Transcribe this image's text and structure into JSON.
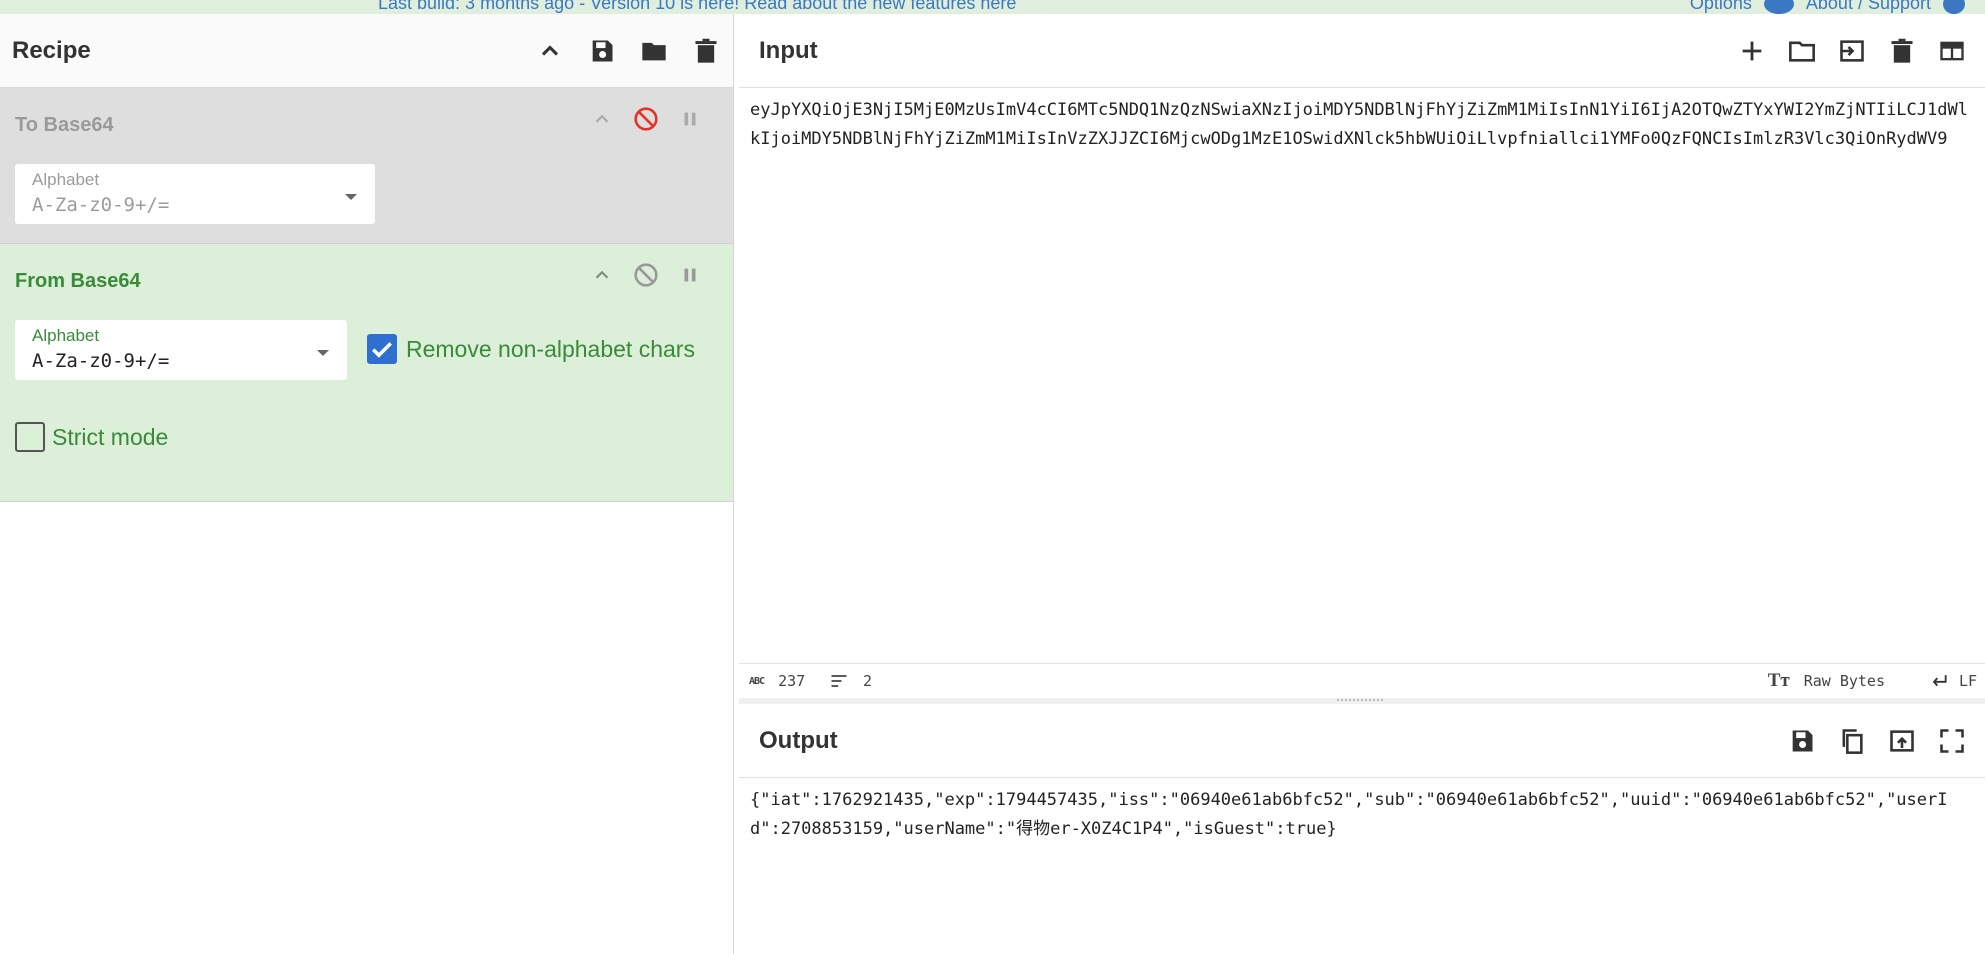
{
  "banner": {
    "text": "Last build: 3 months ago - Version 10 is here! Read about the new features here",
    "options": "Options",
    "about": "About / Support"
  },
  "recipe": {
    "title": "Recipe",
    "operations": [
      {
        "name": "To Base64",
        "disabled": true,
        "alphabet_label": "Alphabet",
        "alphabet_value": "A-Za-z0-9+/="
      },
      {
        "name": "From Base64",
        "disabled": false,
        "alphabet_label": "Alphabet",
        "alphabet_value": "A-Za-z0-9+/=",
        "remove_nonalpha_label": "Remove non-alphabet chars",
        "remove_nonalpha_checked": true,
        "strict_label": "Strict mode",
        "strict_checked": false
      }
    ]
  },
  "input": {
    "title": "Input",
    "text": "eyJpYXQiOjE3NjI5MjE0MzUsImV4cCI6MTc5NDQ1NzQzNSwiaXNzIjoiMDY5NDBlNjFhYjZiZmM1MiIsInN1YiI6IjA2OTQwZTYxYWI2YmZjNTIiLCJ1dWlkIjoiMDY5NDBlNjFhYjZiZmM1MiIsInVzZXJJZCI6MjcwODg1MzE1OSwidXNlck5hbWUiOiLlvpfniallci1YMFo0QzFQNCIsImlzR3Vlc3QiOnRydWV9",
    "status": {
      "chars": "237",
      "lines": "2",
      "encoding": "Raw Bytes",
      "eol": "LF"
    }
  },
  "output": {
    "title": "Output",
    "text": "{\"iat\":1762921435,\"exp\":1794457435,\"iss\":\"06940e61ab6bfc52\",\"sub\":\"06940e61ab6bfc52\",\"uuid\":\"06940e61ab6bfc52\",\"userId\":2708853159,\"userName\":\"得物er-X0Z4C1P4\",\"isGuest\":true}"
  }
}
